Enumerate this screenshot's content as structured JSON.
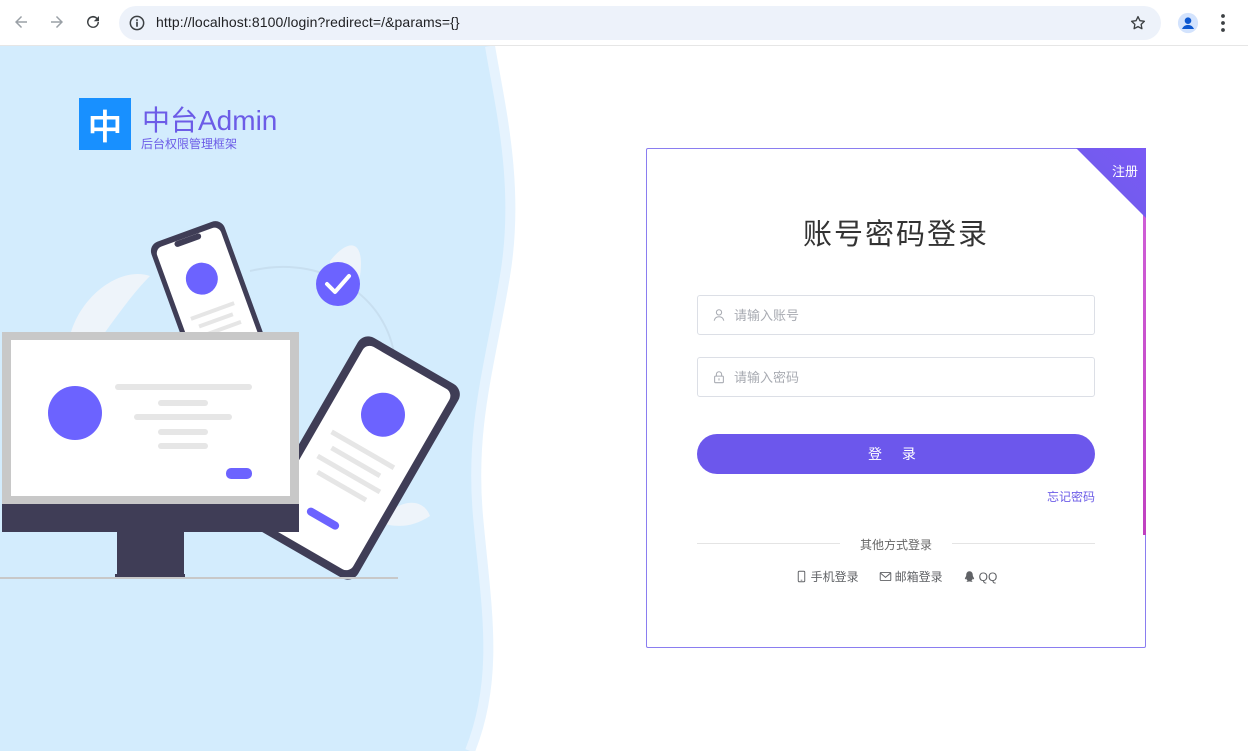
{
  "browser": {
    "url": "http://localhost:8100/login?redirect=/&params={}"
  },
  "brand": {
    "logo_glyph": "中",
    "title": "中台Admin",
    "subtitle": "后台权限管理框架",
    "accent_color": "#6c5ce7",
    "logo_color": "#1890ff"
  },
  "login": {
    "register_label": "注册",
    "title": "账号密码登录",
    "username_placeholder": "请输入账号",
    "password_placeholder": "请输入密码",
    "submit_label": "登 录",
    "forgot_label": "忘记密码",
    "other_methods_label": "其他方式登录",
    "alt_methods": [
      {
        "label": "手机登录",
        "icon": "mobile-icon"
      },
      {
        "label": "邮箱登录",
        "icon": "mail-icon"
      },
      {
        "label": "QQ",
        "icon": "qq-icon"
      }
    ]
  }
}
